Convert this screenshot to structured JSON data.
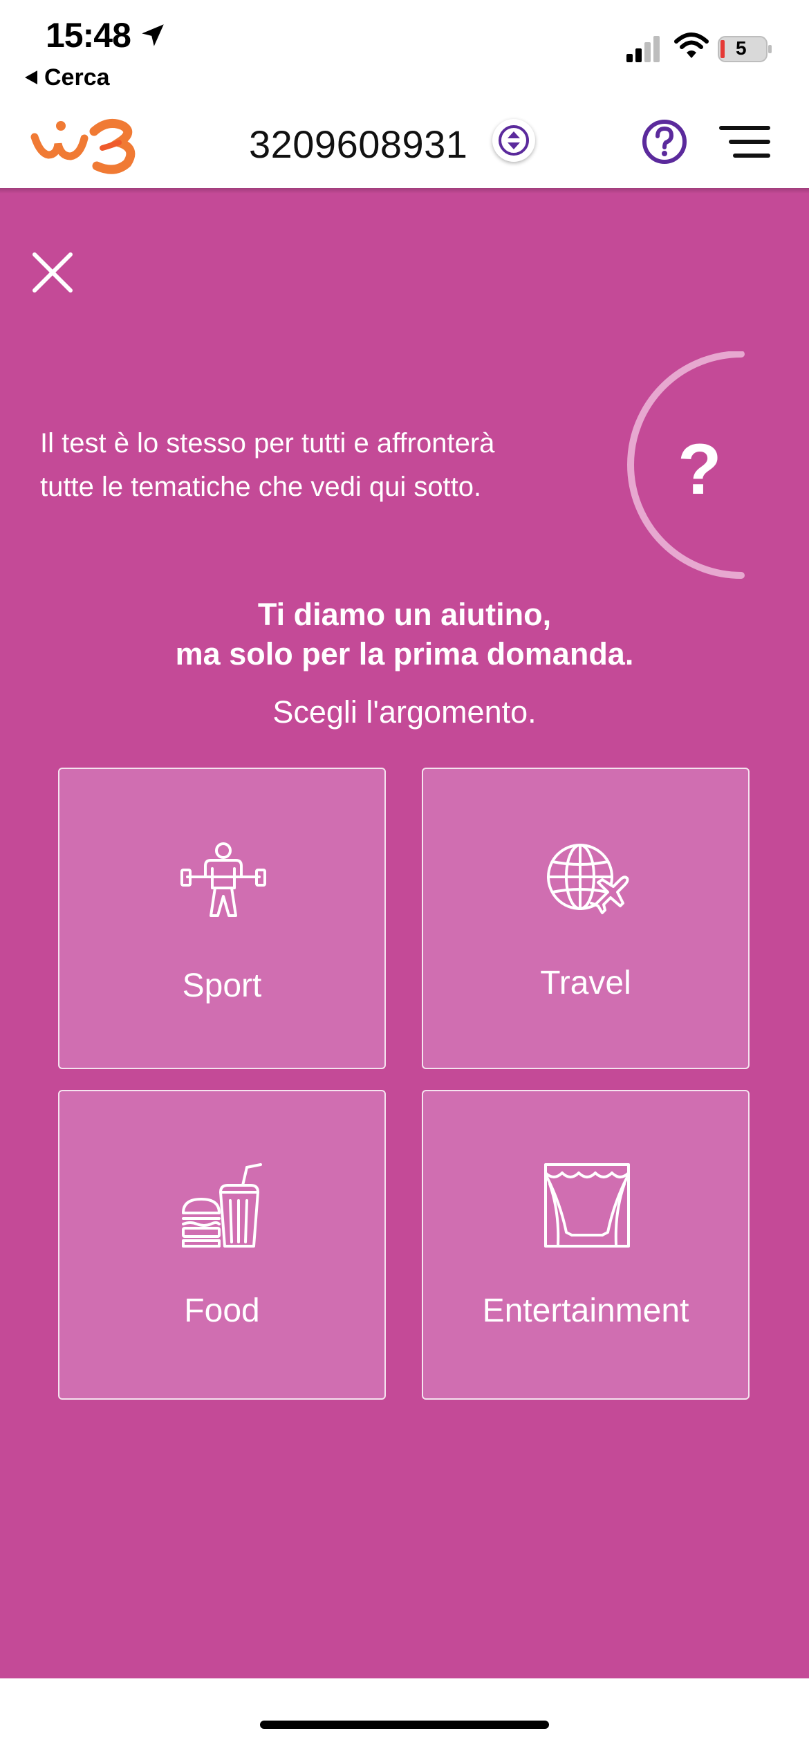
{
  "status_bar": {
    "time": "15:48",
    "back_label": "Cerca",
    "battery_level": "5",
    "icons": [
      "location-arrow-icon",
      "signal-icon",
      "wifi-icon",
      "battery-icon"
    ]
  },
  "header": {
    "logo_name": "windtre-logo",
    "phone_number": "3209608931",
    "icons": [
      "swap-icon",
      "help-icon",
      "menu-icon"
    ]
  },
  "quiz": {
    "intro_line_1": "Il test è lo stesso per tutti e affronterà",
    "intro_line_2": "tutte le tematiche che vedi qui sotto.",
    "question_mark": "?",
    "heading_line_1": "Ti diamo un aiutino,",
    "heading_line_2": "ma solo per la prima domanda.",
    "subheading": "Scegli l'argomento.",
    "topics": [
      {
        "label": "Sport",
        "icon": "weightlifter-icon"
      },
      {
        "label": "Travel",
        "icon": "globe-airplane-icon"
      },
      {
        "label": "Food",
        "icon": "burger-drink-icon"
      },
      {
        "label": "Entertainment",
        "icon": "theater-curtain-icon"
      }
    ]
  },
  "colors": {
    "background_magenta": "#c44a97",
    "tile_fill": "#d06eb1",
    "brand_orange": "#f07a34",
    "brand_purple": "#5b2a9c"
  }
}
